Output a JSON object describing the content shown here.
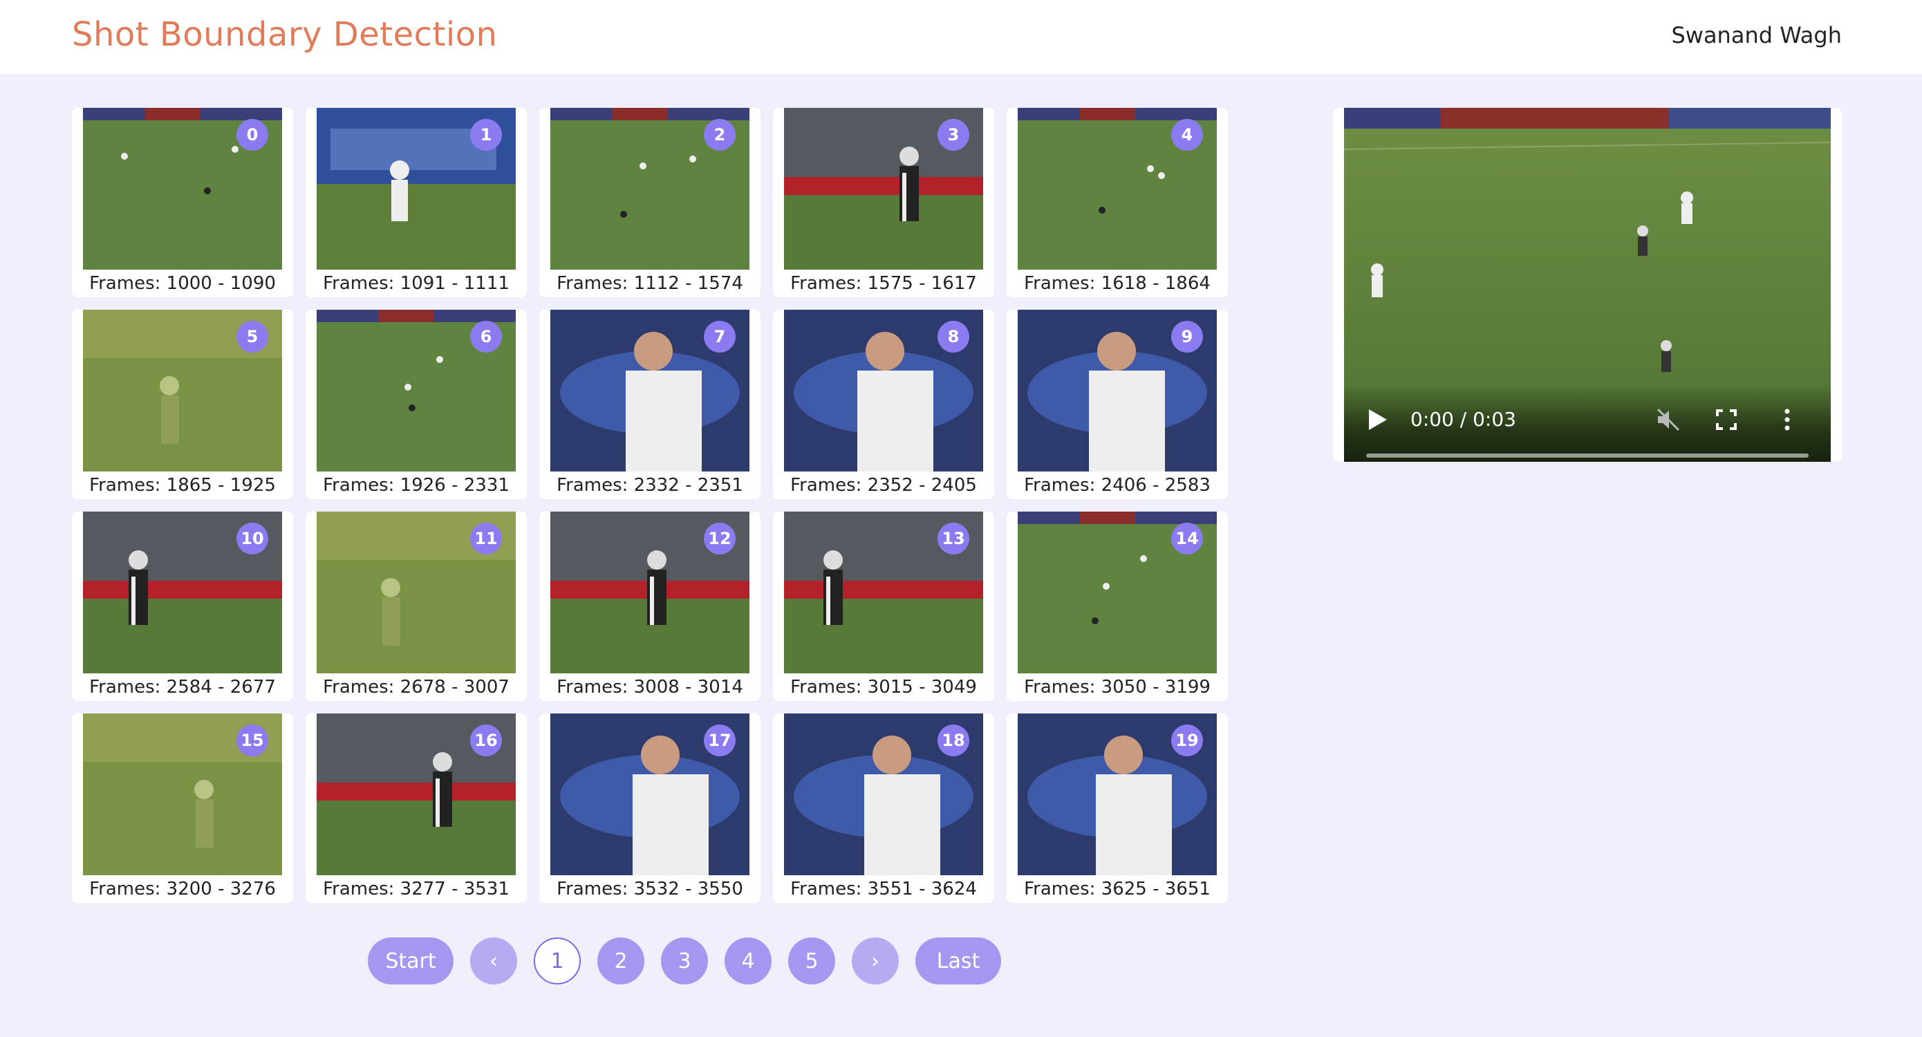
{
  "header": {
    "title": "Shot Boundary Detection",
    "user": "Swanand Wagh"
  },
  "shots": [
    {
      "index": "0",
      "label": "Frames: 1000 - 1090",
      "scene": "wide"
    },
    {
      "index": "1",
      "label": "Frames: 1091 - 1111",
      "scene": "banner"
    },
    {
      "index": "2",
      "label": "Frames: 1112 - 1574",
      "scene": "wide"
    },
    {
      "index": "3",
      "label": "Frames: 1575 - 1617",
      "scene": "stands"
    },
    {
      "index": "4",
      "label": "Frames: 1618 - 1864",
      "scene": "wide"
    },
    {
      "index": "5",
      "label": "Frames: 1865 - 1925",
      "scene": "faded"
    },
    {
      "index": "6",
      "label": "Frames: 1926 - 2331",
      "scene": "wide"
    },
    {
      "index": "7",
      "label": "Frames: 2332 - 2351",
      "scene": "closeup"
    },
    {
      "index": "8",
      "label": "Frames: 2352 - 2405",
      "scene": "closeup"
    },
    {
      "index": "9",
      "label": "Frames: 2406 - 2583",
      "scene": "closeup"
    },
    {
      "index": "10",
      "label": "Frames: 2584 - 2677",
      "scene": "stands"
    },
    {
      "index": "11",
      "label": "Frames: 2678 - 3007",
      "scene": "faded"
    },
    {
      "index": "12",
      "label": "Frames: 3008 - 3014",
      "scene": "stands"
    },
    {
      "index": "13",
      "label": "Frames: 3015 - 3049",
      "scene": "stands"
    },
    {
      "index": "14",
      "label": "Frames: 3050 - 3199",
      "scene": "wide"
    },
    {
      "index": "15",
      "label": "Frames: 3200 - 3276",
      "scene": "faded"
    },
    {
      "index": "16",
      "label": "Frames: 3277 - 3531",
      "scene": "stands"
    },
    {
      "index": "17",
      "label": "Frames: 3532 - 3550",
      "scene": "closeup"
    },
    {
      "index": "18",
      "label": "Frames: 3551 - 3624",
      "scene": "closeup"
    },
    {
      "index": "19",
      "label": "Frames: 3625 - 3651",
      "scene": "closeup"
    }
  ],
  "player": {
    "time": "0:00 / 0:03",
    "progress": 0
  },
  "pagination": {
    "start": "Start",
    "prev": "‹",
    "pages": [
      "1",
      "2",
      "3",
      "4",
      "5"
    ],
    "current": "1",
    "next": "›",
    "last": "Last"
  },
  "colors": {
    "title": "#e07c5a",
    "accent": "#8a7bf0",
    "background": "#efeefb"
  }
}
